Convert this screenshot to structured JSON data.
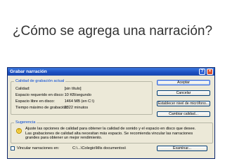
{
  "slide": {
    "title": "¿Cómo se agrega una narración?"
  },
  "dialog": {
    "title": "Grabar narración",
    "quality_group": {
      "label": "Calidad de grabación actual",
      "rows": [
        {
          "label": "Calidad:",
          "value": "[sin título]"
        },
        {
          "label": "Espacio requerido en disco:",
          "value": "10 KB/segundo"
        },
        {
          "label": "Espacio libre en disco:",
          "value": "1464 MB (en C:\\)"
        },
        {
          "label": "Tiempo máximo de grabación:",
          "value": "2322 minutos"
        }
      ]
    },
    "buttons": {
      "accept": "Aceptar",
      "cancel": "Cancelar",
      "mic_level": "Establecer nivel de micrófono...",
      "change_quality": "Cambiar calidad..."
    },
    "tip_group": {
      "label": "Sugerencia",
      "text": "Ajuste las opciones de calidad para obtener la calidad de sonido y el espacio en disco que desee. Las grabaciones de calidad alta necesitan más espacio. Se recomienda vincular las narraciones grandes para obtener un mejor rendimiento."
    },
    "link_narrations": {
      "label": "Vincular narraciones en:",
      "path": "C:\\...\\Colegio\\Mis documentos\\",
      "browse": "Examinar..."
    }
  }
}
